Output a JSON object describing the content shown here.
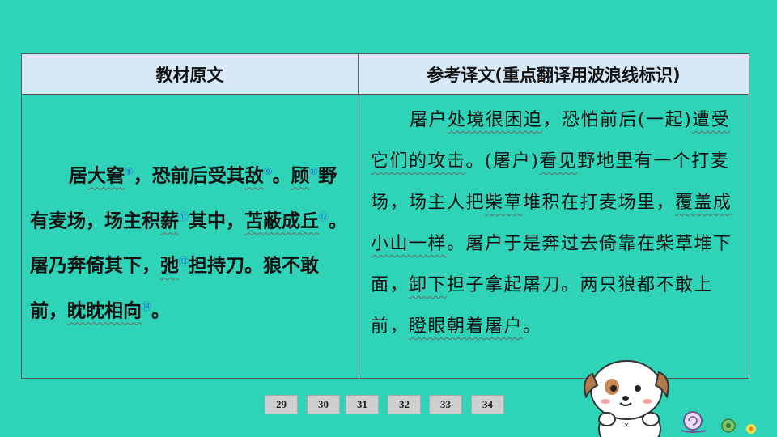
{
  "table": {
    "header_left": "教材原文",
    "header_right": "参考译文(重点翻译用波浪线标识)",
    "left": {
      "t1": "居",
      "w1": "大窘",
      "n1": "⑧",
      "t2": "，恐前后受其",
      "w2": "敌",
      "n2": "⑨",
      "t3": "。",
      "w3": "顾",
      "n3": "⑩",
      "t4": "野有麦场，场主积",
      "w4": "薪",
      "n4": "⑪",
      "t5": "其中，",
      "w5": "苫蔽成丘",
      "n5": "⑫",
      "t6": "。屠乃奔倚其下，",
      "w6": "弛",
      "n6": "⑬",
      "t7": "担持刀。狼不敢前，",
      "w7": "眈眈相向",
      "n7": "⑭",
      "t8": "。"
    },
    "right": {
      "t1": "屠户",
      "w1": "处境很困迫",
      "t2": "，恐怕前后(一起)",
      "w2": "遭受它们的攻击",
      "t3": "。(屠户)",
      "w3": "看见",
      "t4": "野地里有一个打麦场，场主人把",
      "w4": "柴草",
      "t5": "堆积在打麦场里，",
      "w5": "覆盖成小山一样",
      "t6": "。屠户于是奔过去倚靠在柴草堆下面，",
      "w6": "卸下",
      "t7": "担子拿起屠刀。两只狼都不敢上前，",
      "w7": "瞪眼朝着屠户",
      "t8": "。"
    }
  },
  "pager": [
    "29",
    "30",
    "31",
    "32",
    "33",
    "34"
  ]
}
